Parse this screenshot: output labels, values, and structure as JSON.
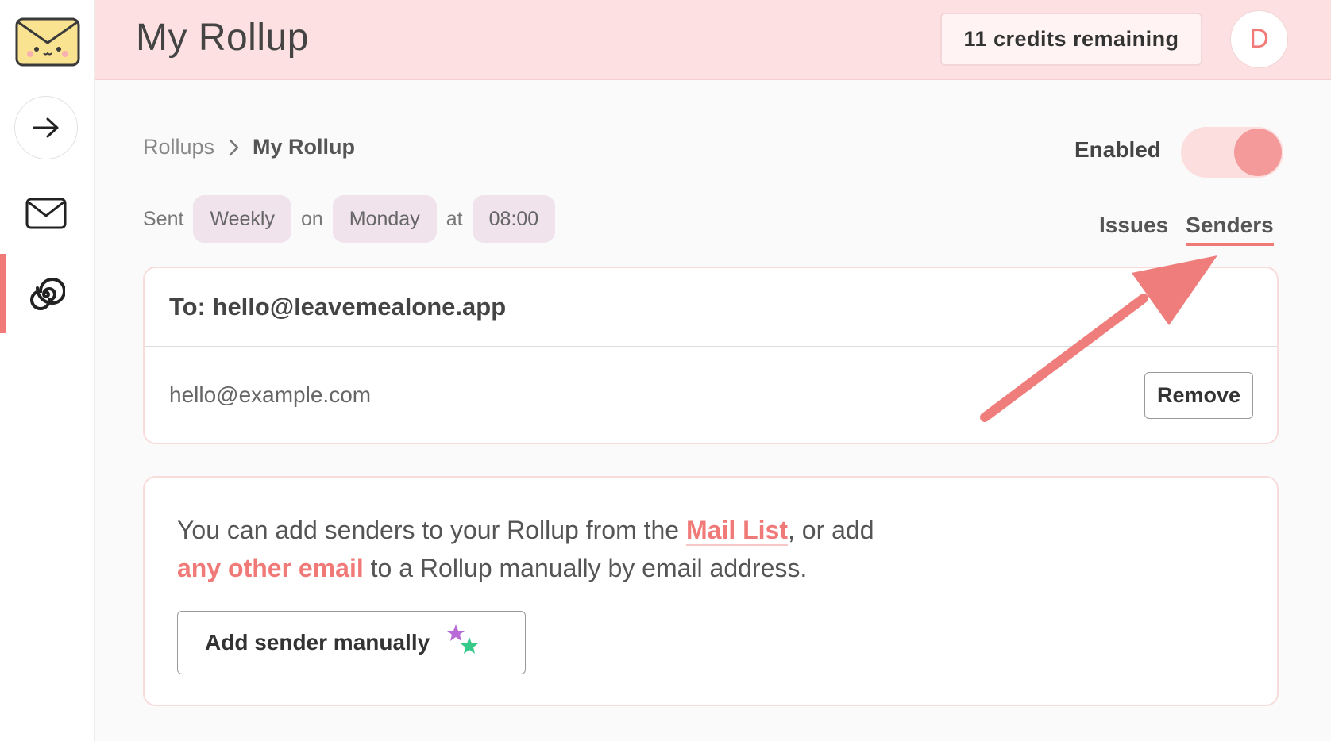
{
  "header": {
    "title": "My Rollup",
    "credits": "11 credits remaining",
    "avatar_initial": "D"
  },
  "sidebar": {
    "items": [
      {
        "name": "arrow-right-icon"
      },
      {
        "name": "mail-icon"
      },
      {
        "name": "spiral-icon",
        "active": true
      }
    ]
  },
  "breadcrumb": {
    "parent": "Rollups",
    "current": "My Rollup"
  },
  "toggle": {
    "label": "Enabled",
    "state": true
  },
  "schedule": {
    "sent": "Sent",
    "frequency": "Weekly",
    "on": "on",
    "day": "Monday",
    "at": "at",
    "time": "08:00"
  },
  "tabs": [
    {
      "label": "Issues",
      "active": false
    },
    {
      "label": "Senders",
      "active": true
    }
  ],
  "recipient": {
    "to": "To: hello@leavemealone.app"
  },
  "senders": [
    {
      "email": "hello@example.com",
      "action": "Remove"
    }
  ],
  "info": {
    "part1": "You can add senders to your Rollup from the ",
    "link1": "Mail List",
    "part2": ", or add ",
    "link2": "any other email",
    "part3": " to a Rollup manually by email address."
  },
  "add_button": {
    "label": "Add sender manually"
  },
  "colors": {
    "accent": "#f07a78",
    "header_bg": "#fde0e1",
    "pill_bg": "#f0e3ec"
  }
}
